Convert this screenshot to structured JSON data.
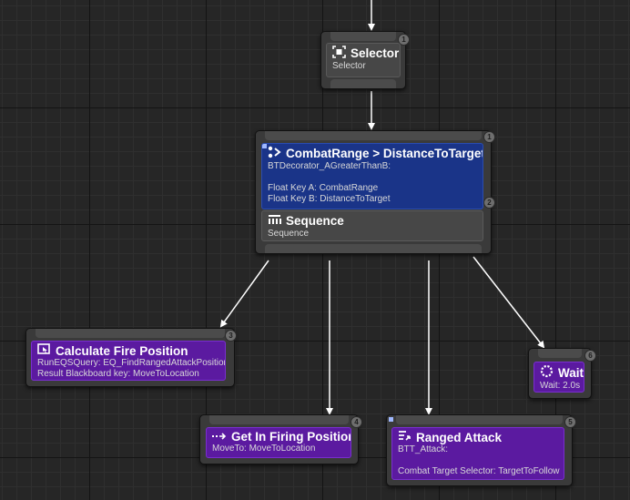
{
  "nodes": {
    "selector": {
      "title": "Selector",
      "subtitle": "Selector",
      "index": "1",
      "icon": "selector-icon"
    },
    "sequence": {
      "decorator": {
        "title": "CombatRange > DistanceToTarget",
        "class": "BTDecorator_AGreaterThanB:",
        "key_a": "Float Key A: CombatRange",
        "key_b": "Float Key B: DistanceToTarget",
        "index": "2",
        "icon": "decorator-icon"
      },
      "title": "Sequence",
      "subtitle": "Sequence",
      "index": "1",
      "icon": "sequence-icon"
    },
    "calc_fire": {
      "title": "Calculate Fire Position",
      "line1": "RunEQSQuery: EQ_FindRangedAttackPosition",
      "line2": "Result Blackboard key: MoveToLocation",
      "index": "3",
      "icon": "eqs-icon"
    },
    "get_in_firing": {
      "title": "Get In Firing Position",
      "subtitle": "MoveTo: MoveToLocation",
      "index": "4",
      "icon": "moveto-icon"
    },
    "ranged_attack": {
      "title": "Ranged Attack",
      "line1": "BTT_Attack:",
      "line2": "Combat Target Selector: TargetToFollow",
      "index": "5",
      "icon": "task-icon"
    },
    "wait": {
      "title": "Wait",
      "subtitle": "Wait: 2.0s",
      "index": "6",
      "icon": "wait-icon"
    }
  },
  "colors": {
    "task": "#5b1aa0",
    "decorator": "#1a3488",
    "composite": "#474747",
    "wire": "#ffffff"
  }
}
